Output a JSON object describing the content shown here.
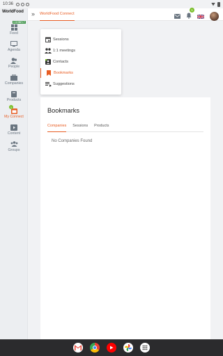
{
  "statusbar": {
    "time": "10:36"
  },
  "app": {
    "logo_line1": "WorldFood",
    "logo_line2": "CONNECT"
  },
  "sidebar": {
    "items": [
      {
        "label": "Feed",
        "icon": "feed-icon"
      },
      {
        "label": "Agenda",
        "icon": "agenda-icon"
      },
      {
        "label": "People",
        "icon": "people-icon"
      },
      {
        "label": "Companies",
        "icon": "companies-icon"
      },
      {
        "label": "Products",
        "icon": "products-icon"
      },
      {
        "label": "My Connect",
        "icon": "my-connect-icon",
        "active": true,
        "badge": "1"
      },
      {
        "label": "Content",
        "icon": "content-icon"
      },
      {
        "label": "Groups",
        "icon": "groups-icon"
      }
    ]
  },
  "topbar": {
    "tab_label": "WorldFood Connect",
    "notification_count": "1"
  },
  "menu": {
    "items": [
      {
        "label": "Sessions",
        "icon": "calendar-icon"
      },
      {
        "label": "1:1 meetings",
        "icon": "meetings-icon"
      },
      {
        "label": "Contacts",
        "icon": "contacts-icon"
      },
      {
        "label": "Bookmarks",
        "icon": "bookmark-icon",
        "active": true
      },
      {
        "label": "Suggestions",
        "icon": "suggestions-icon"
      }
    ]
  },
  "main": {
    "title": "Bookmarks",
    "tabs": [
      {
        "label": "Companies",
        "active": true
      },
      {
        "label": "Sessions"
      },
      {
        "label": "Products"
      }
    ],
    "empty_message": "No Companies Found"
  },
  "colors": {
    "accent": "#e85d23",
    "badge": "#7bbf2b",
    "sidebar_bg": "#eceef1",
    "icon": "#6a7580"
  }
}
